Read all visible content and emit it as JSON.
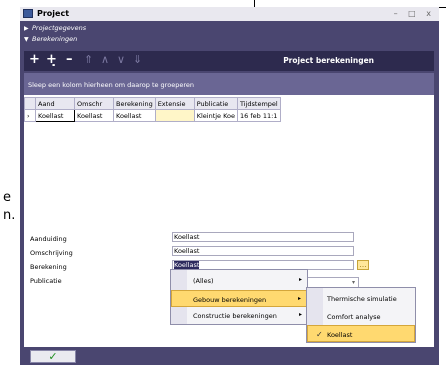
{
  "background_text": {
    "line1": "e",
    "line2": "n."
  },
  "window": {
    "title": "Project",
    "controls": "– □ x",
    "icon": "project-window-icon"
  },
  "nav": {
    "items": [
      {
        "label": "Projectgegevens",
        "state": "collapsed",
        "icon": "triangle-right-icon"
      },
      {
        "label": "Berekeningen",
        "state": "expanded",
        "icon": "triangle-down-icon"
      }
    ]
  },
  "toolbar": {
    "title": "Project berekeningen",
    "buttons": [
      {
        "name": "add",
        "glyph": "+"
      },
      {
        "name": "add-child",
        "glyph": "+̣"
      },
      {
        "name": "remove",
        "glyph": "–"
      },
      {
        "name": "move-top",
        "glyph": "⇑"
      },
      {
        "name": "move-up",
        "glyph": "∧"
      },
      {
        "name": "move-down",
        "glyph": "∨"
      },
      {
        "name": "move-bottom",
        "glyph": "⇓"
      }
    ]
  },
  "grid": {
    "group_hint": "Sleep een kolom hierheen om daarop te groeperen",
    "columns": [
      "",
      "Aand",
      "Omschr",
      "Berekening",
      "Extensie",
      "Publicatie",
      "Tijdstempel"
    ],
    "rows": [
      [
        "›",
        "Koellast",
        "Koellast",
        "Koellast",
        "",
        "Kleintje Koe",
        "16 feb 11:1"
      ]
    ]
  },
  "form": {
    "fields": [
      {
        "label": "Aanduiding",
        "value": "Koellast"
      },
      {
        "label": "Omschrijving",
        "value": "Koellast"
      },
      {
        "label": "Berekening",
        "value": "Koellast"
      },
      {
        "label": "Publicatie",
        "value": ""
      }
    ],
    "dropdown_glyph": "…",
    "combo_glyph": "▾"
  },
  "menu_main": {
    "items": [
      {
        "label": "(Alles)",
        "submenu": true
      },
      {
        "label": "Gebouw berekeningen",
        "submenu": true,
        "active": true
      },
      {
        "label": "Constructie berekeningen",
        "submenu": true
      }
    ],
    "arrow": "▸"
  },
  "menu_sub": {
    "items": [
      {
        "label": "Thermische simulatie",
        "checked": false
      },
      {
        "label": "Comfort analyse",
        "checked": false
      },
      {
        "label": "Koellast",
        "checked": true,
        "active": true
      }
    ],
    "check_glyph": "✓"
  },
  "footer": {
    "ok_glyph": "✓"
  },
  "colors": {
    "window_bg": "#4a4670",
    "toolbar_bg": "#2d2a4e",
    "group_header": "#6a6694",
    "menu_highlight": "#ffd970",
    "ok_green": "#1f8f1f"
  }
}
